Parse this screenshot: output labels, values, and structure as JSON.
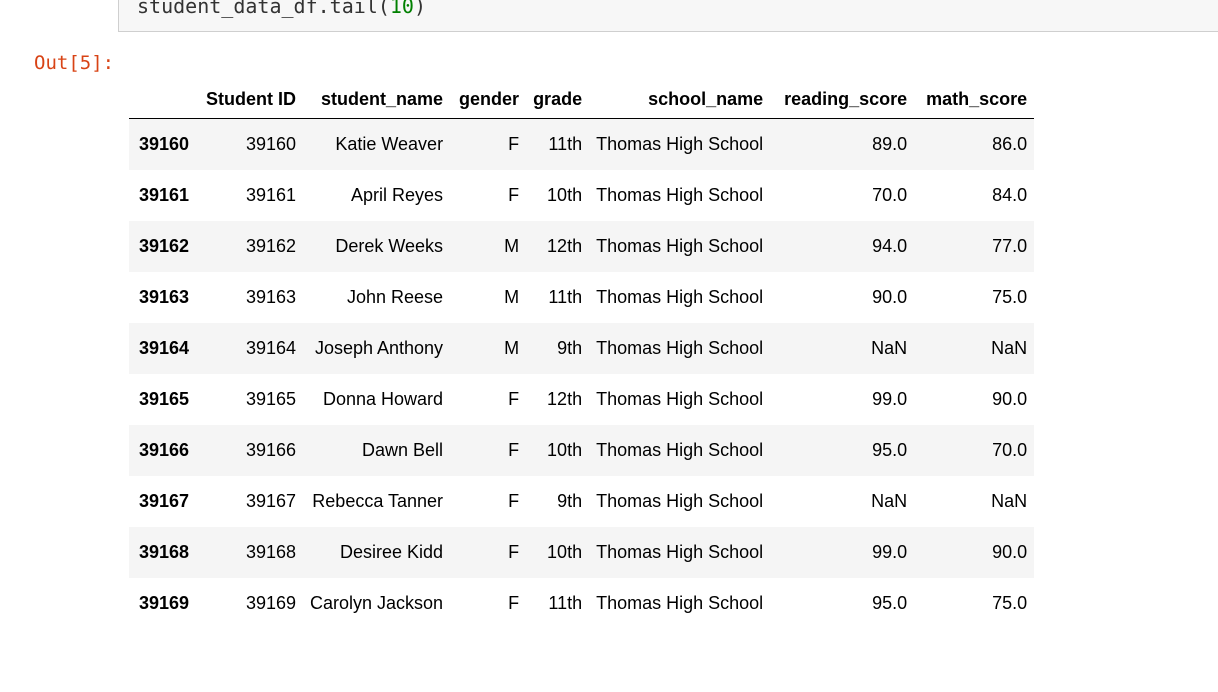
{
  "input_cell": {
    "code_prefix": "student_data_df.tail(",
    "code_arg": "10",
    "code_suffix": ")"
  },
  "output_prompt": "Out[5]:",
  "table": {
    "columns": [
      "Student ID",
      "student_name",
      "gender",
      "grade",
      "school_name",
      "reading_score",
      "math_score"
    ],
    "rows": [
      {
        "index": "39160",
        "cells": [
          "39160",
          "Katie Weaver",
          "F",
          "11th",
          "Thomas High School",
          "89.0",
          "86.0"
        ]
      },
      {
        "index": "39161",
        "cells": [
          "39161",
          "April Reyes",
          "F",
          "10th",
          "Thomas High School",
          "70.0",
          "84.0"
        ]
      },
      {
        "index": "39162",
        "cells": [
          "39162",
          "Derek Weeks",
          "M",
          "12th",
          "Thomas High School",
          "94.0",
          "77.0"
        ]
      },
      {
        "index": "39163",
        "cells": [
          "39163",
          "John Reese",
          "M",
          "11th",
          "Thomas High School",
          "90.0",
          "75.0"
        ]
      },
      {
        "index": "39164",
        "cells": [
          "39164",
          "Joseph Anthony",
          "M",
          "9th",
          "Thomas High School",
          "NaN",
          "NaN"
        ]
      },
      {
        "index": "39165",
        "cells": [
          "39165",
          "Donna Howard",
          "F",
          "12th",
          "Thomas High School",
          "99.0",
          "90.0"
        ]
      },
      {
        "index": "39166",
        "cells": [
          "39166",
          "Dawn Bell",
          "F",
          "10th",
          "Thomas High School",
          "95.0",
          "70.0"
        ]
      },
      {
        "index": "39167",
        "cells": [
          "39167",
          "Rebecca Tanner",
          "F",
          "9th",
          "Thomas High School",
          "NaN",
          "NaN"
        ]
      },
      {
        "index": "39168",
        "cells": [
          "39168",
          "Desiree Kidd",
          "F",
          "10th",
          "Thomas High School",
          "99.0",
          "90.0"
        ]
      },
      {
        "index": "39169",
        "cells": [
          "39169",
          "Carolyn Jackson",
          "F",
          "11th",
          "Thomas High School",
          "95.0",
          "75.0"
        ]
      }
    ]
  }
}
